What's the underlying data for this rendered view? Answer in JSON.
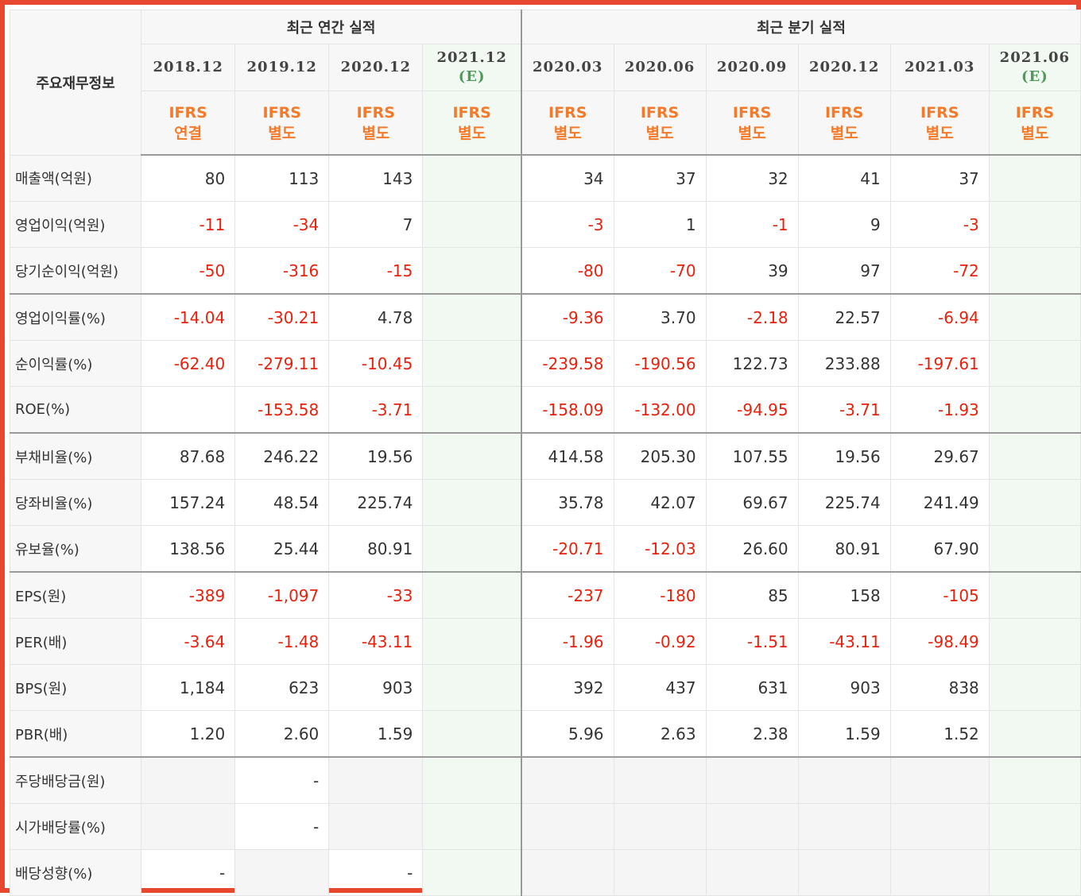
{
  "header": {
    "row_label_title": "주요재무정보",
    "annual_group": "최근 연간 실적",
    "quarter_group": "최근 분기 실적",
    "annual_periods": [
      {
        "period": "2018.12",
        "est": "",
        "ifrs1": "IFRS",
        "ifrs2": "연결"
      },
      {
        "period": "2019.12",
        "est": "",
        "ifrs1": "IFRS",
        "ifrs2": "별도"
      },
      {
        "period": "2020.12",
        "est": "",
        "ifrs1": "IFRS",
        "ifrs2": "별도"
      },
      {
        "period": "2021.12",
        "est": "(E)",
        "ifrs1": "IFRS",
        "ifrs2": "별도"
      }
    ],
    "quarter_periods": [
      {
        "period": "2020.03",
        "est": "",
        "ifrs1": "IFRS",
        "ifrs2": "별도"
      },
      {
        "period": "2020.06",
        "est": "",
        "ifrs1": "IFRS",
        "ifrs2": "별도"
      },
      {
        "period": "2020.09",
        "est": "",
        "ifrs1": "IFRS",
        "ifrs2": "별도"
      },
      {
        "period": "2020.12",
        "est": "",
        "ifrs1": "IFRS",
        "ifrs2": "별도"
      },
      {
        "period": "2021.03",
        "est": "",
        "ifrs1": "IFRS",
        "ifrs2": "별도"
      },
      {
        "period": "2021.06",
        "est": "(E)",
        "ifrs1": "IFRS",
        "ifrs2": "별도"
      }
    ]
  },
  "rows": [
    {
      "label": "매출액(억원)",
      "values": [
        "80",
        "113",
        "143",
        "",
        "34",
        "37",
        "32",
        "41",
        "37",
        ""
      ]
    },
    {
      "label": "영업이익(억원)",
      "values": [
        "-11",
        "-34",
        "7",
        "",
        "-3",
        "1",
        "-1",
        "9",
        "-3",
        ""
      ]
    },
    {
      "label": "당기순이익(억원)",
      "values": [
        "-50",
        "-316",
        "-15",
        "",
        "-80",
        "-70",
        "39",
        "97",
        "-72",
        ""
      ]
    },
    {
      "label": "영업이익률(%)",
      "values": [
        "-14.04",
        "-30.21",
        "4.78",
        "",
        "-9.36",
        "3.70",
        "-2.18",
        "22.57",
        "-6.94",
        ""
      ]
    },
    {
      "label": "순이익률(%)",
      "values": [
        "-62.40",
        "-279.11",
        "-10.45",
        "",
        "-239.58",
        "-190.56",
        "122.73",
        "233.88",
        "-197.61",
        ""
      ]
    },
    {
      "label": "ROE(%)",
      "values": [
        "",
        "-153.58",
        "-3.71",
        "",
        "-158.09",
        "-132.00",
        "-94.95",
        "-3.71",
        "-1.93",
        ""
      ]
    },
    {
      "label": "부채비율(%)",
      "values": [
        "87.68",
        "246.22",
        "19.56",
        "",
        "414.58",
        "205.30",
        "107.55",
        "19.56",
        "29.67",
        ""
      ]
    },
    {
      "label": "당좌비율(%)",
      "values": [
        "157.24",
        "48.54",
        "225.74",
        "",
        "35.78",
        "42.07",
        "69.67",
        "225.74",
        "241.49",
        ""
      ]
    },
    {
      "label": "유보율(%)",
      "values": [
        "138.56",
        "25.44",
        "80.91",
        "",
        "-20.71",
        "-12.03",
        "26.60",
        "80.91",
        "67.90",
        ""
      ]
    },
    {
      "label": "EPS(원)",
      "values": [
        "-389",
        "-1,097",
        "-33",
        "",
        "-237",
        "-180",
        "85",
        "158",
        "-105",
        ""
      ]
    },
    {
      "label": "PER(배)",
      "values": [
        "-3.64",
        "-1.48",
        "-43.11",
        "",
        "-1.96",
        "-0.92",
        "-1.51",
        "-43.11",
        "-98.49",
        ""
      ]
    },
    {
      "label": "BPS(원)",
      "values": [
        "1,184",
        "623",
        "903",
        "",
        "392",
        "437",
        "631",
        "903",
        "838",
        ""
      ]
    },
    {
      "label": "PBR(배)",
      "values": [
        "1.20",
        "2.60",
        "1.59",
        "",
        "5.96",
        "2.63",
        "2.38",
        "1.59",
        "1.52",
        ""
      ]
    },
    {
      "label": "주당배당금(원)",
      "values": [
        "",
        "-",
        "",
        "",
        "",
        "",
        "",
        "",
        "",
        ""
      ],
      "blank": [
        true,
        false,
        true,
        false,
        true,
        true,
        true,
        true,
        true,
        false
      ]
    },
    {
      "label": "시가배당률(%)",
      "values": [
        "",
        "-",
        "",
        "",
        "",
        "",
        "",
        "",
        "",
        ""
      ],
      "blank": [
        true,
        false,
        true,
        false,
        true,
        true,
        true,
        true,
        true,
        false
      ]
    },
    {
      "label": "배당성향(%)",
      "values": [
        "-",
        "",
        "-",
        "",
        "",
        "",
        "",
        "",
        "",
        ""
      ],
      "blank": [
        false,
        true,
        false,
        false,
        true,
        true,
        true,
        true,
        true,
        false
      ]
    }
  ]
}
